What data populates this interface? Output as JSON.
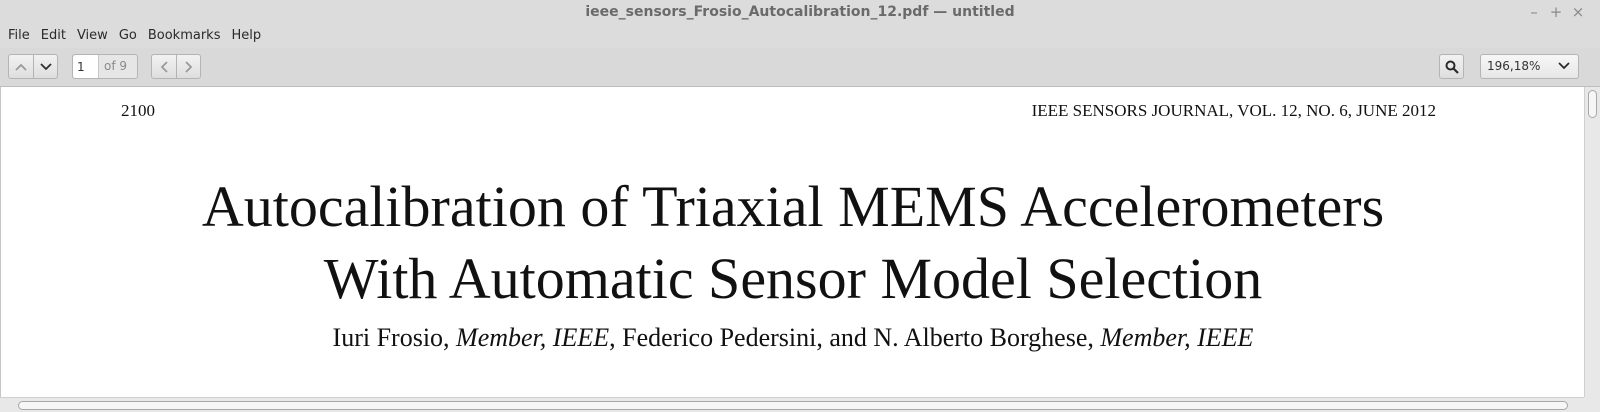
{
  "window": {
    "title": "ieee_sensors_Frosio_Autocalibration_12.pdf — untitled",
    "controls": {
      "minimize": "–",
      "maximize": "+",
      "close": "×"
    }
  },
  "menu": [
    "File",
    "Edit",
    "View",
    "Go",
    "Bookmarks",
    "Help"
  ],
  "toolbar": {
    "page_input": "1",
    "page_total": "of 9",
    "zoom": "196,18%",
    "icons": [
      "chevron-up-icon",
      "chevron-down-icon",
      "chevron-left-icon",
      "chevron-right-icon",
      "search-icon",
      "caret-down-icon"
    ]
  },
  "document": {
    "page_number": "2100",
    "journal": "IEEE SENSORS JOURNAL, VOL. 12, NO. 6, JUNE 2012",
    "title_line1": "Autocalibration of Triaxial MEMS Accelerometers",
    "title_line2": "With Automatic Sensor Model Selection",
    "authors": {
      "a1": "Iuri Frosio, ",
      "a1_role": "Member, IEEE",
      "a2": ", Federico Pedersini, and N. Alberto Borghese, ",
      "a2_role": "Member, IEEE"
    }
  }
}
